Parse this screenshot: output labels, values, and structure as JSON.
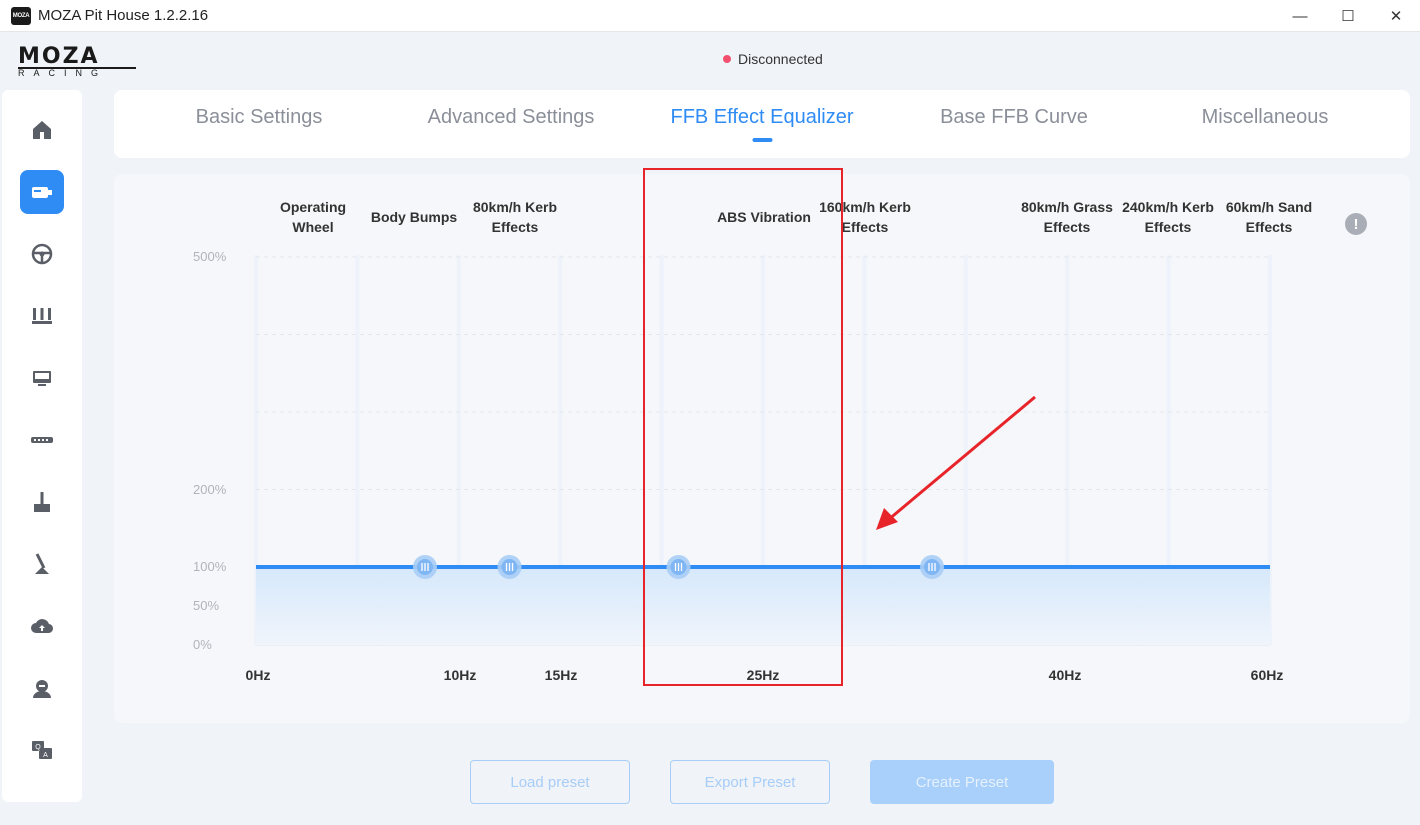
{
  "window": {
    "app_icon_text": "MOZA",
    "title": "MOZA Pit House 1.2.2.16",
    "minimize": "—",
    "maximize": "☐",
    "close": "✕"
  },
  "header": {
    "logo_main": "MOZA",
    "logo_sub": "RACING",
    "status": "Disconnected",
    "status_color": "#f0506e"
  },
  "sidebar": {
    "items": [
      {
        "icon": "home-icon",
        "active": false
      },
      {
        "icon": "wheelbase-icon",
        "active": true
      },
      {
        "icon": "steering-wheel-icon",
        "active": false
      },
      {
        "icon": "pedals-icon",
        "active": false
      },
      {
        "icon": "dashboard-icon",
        "active": false
      },
      {
        "icon": "handbrake-bar-icon",
        "active": false
      },
      {
        "icon": "joystick-icon",
        "active": false
      },
      {
        "icon": "shifter-icon",
        "active": false
      },
      {
        "icon": "cloud-upload-icon",
        "active": false
      },
      {
        "icon": "user-icon",
        "active": false
      },
      {
        "icon": "qa-help-icon",
        "active": false
      }
    ]
  },
  "tabs": [
    {
      "label": "Basic Settings",
      "active": false
    },
    {
      "label": "Advanced Settings",
      "active": false
    },
    {
      "label": "FFB Effect Equalizer",
      "active": true
    },
    {
      "label": "Base FFB Curve",
      "active": false
    },
    {
      "label": "Miscellaneous",
      "active": false
    }
  ],
  "equalizer": {
    "band_labels": [
      {
        "line1": "Operating",
        "line2": "Wheel"
      },
      {
        "line1": "Body Bumps",
        "line2": ""
      },
      {
        "line1": "80km/h Kerb",
        "line2": "Effects"
      },
      {
        "line1": "ABS Vibration",
        "line2": ""
      },
      {
        "line1": "160km/h Kerb",
        "line2": "Effects"
      },
      {
        "line1": "80km/h Grass",
        "line2": "Effects"
      },
      {
        "line1": "240km/h Kerb",
        "line2": "Effects"
      },
      {
        "line1": "60km/h Sand",
        "line2": "Effects"
      }
    ],
    "info_icon": "!",
    "y_ticks": [
      "500%",
      "200%",
      "100%",
      "50%",
      "0%"
    ],
    "x_ticks": [
      "0Hz",
      "10Hz",
      "15Hz",
      "25Hz",
      "40Hz",
      "60Hz"
    ],
    "handles_hz": [
      10,
      15,
      25,
      40
    ],
    "level_percent": 100,
    "line_color": "#2f8cf5"
  },
  "buttons": {
    "load_preset": "Load preset",
    "export_preset": "Export Preset",
    "create_preset": "Create Preset"
  }
}
